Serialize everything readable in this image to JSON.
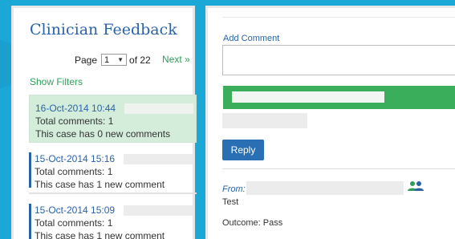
{
  "colors": {
    "background": "#1ca8d6",
    "link_blue": "#2a63a8",
    "link_green": "#2ca05a",
    "active_row": "#d4eddb",
    "green_bar": "#3aae5a",
    "reply_button": "#2a6fb3"
  },
  "feedback": {
    "title": "Clinician Feedback",
    "pager": {
      "label": "Page",
      "selected": "1",
      "of_label": "of 22",
      "next": "Next »"
    },
    "show_filters": "Show Filters",
    "cases": [
      {
        "date": "16-Oct-2014 10:44",
        "total": "Total comments: 1",
        "new": "This case has 0 new comments",
        "active": true
      },
      {
        "date": "15-Oct-2014 15:16",
        "total": "Total comments: 1",
        "new": "This case has 1 new comment",
        "active": false
      },
      {
        "date": "15-Oct-2014 15:09",
        "total": "Total comments: 1",
        "new": "This case has 1 new comment",
        "active": false
      }
    ]
  },
  "detail": {
    "add_comment_label": "Add Comment",
    "reply_label": "Reply",
    "from_label": "From:",
    "comment_text": "Test",
    "outcome": "Outcome: Pass",
    "people_icon": "people-icon"
  }
}
